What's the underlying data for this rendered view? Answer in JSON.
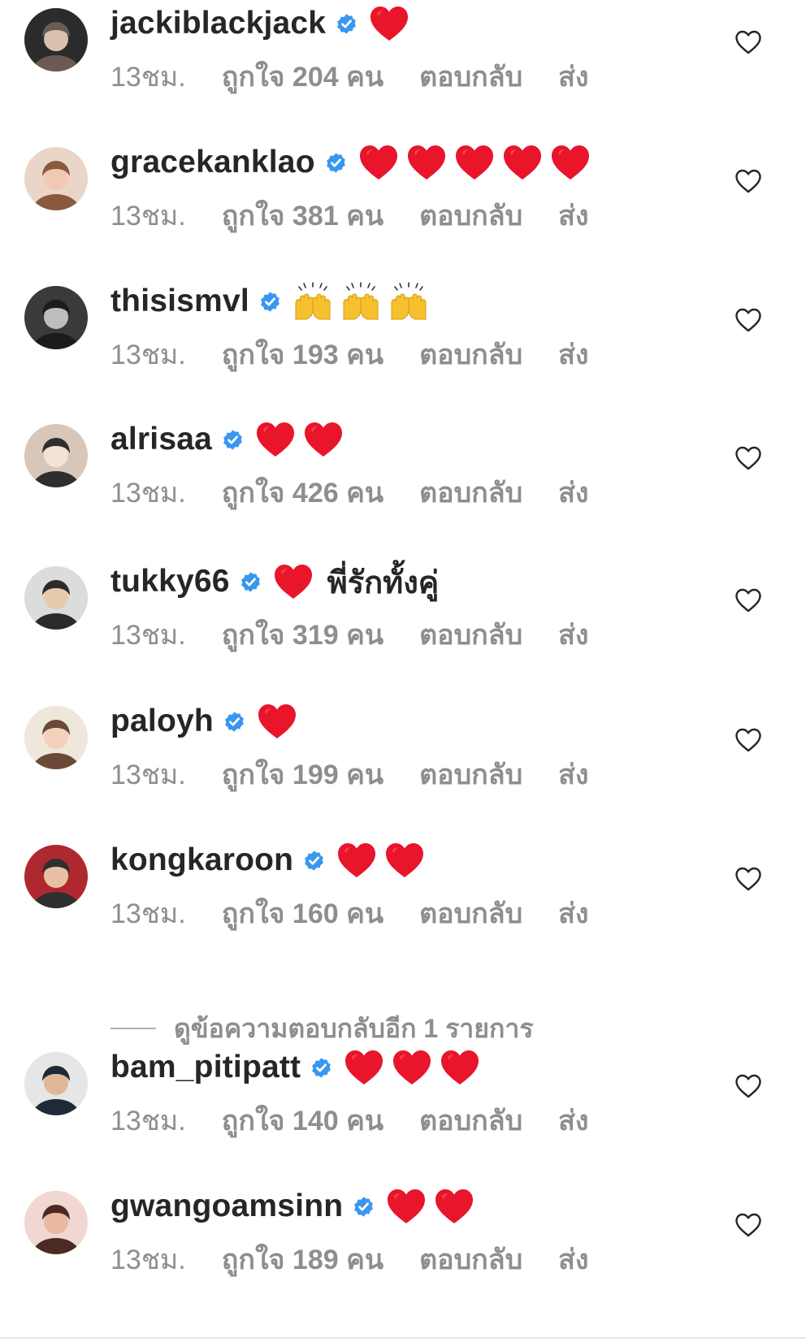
{
  "colors": {
    "text": "#262626",
    "meta": "#8e8e8e",
    "verified_blue": "#3897f0",
    "heart_red": "#e0245e"
  },
  "icons": {
    "verified": "verified-badge-icon",
    "like": "heart-outline-icon",
    "emoji_heart": "red-heart-emoji",
    "emoji_hands": "raising-hands-emoji"
  },
  "comments": [
    {
      "username": "jackiblackjack",
      "emoji": [
        "heart"
      ],
      "text": "",
      "time": "13ชม.",
      "likes": "ถูกใจ 204 คน",
      "reply": "ตอบกลับ",
      "send": "ส่ง"
    },
    {
      "username": "gracekanklao",
      "emoji": [
        "heart",
        "heart",
        "heart",
        "heart",
        "heart"
      ],
      "text": "",
      "time": "13ชม.",
      "likes": "ถูกใจ 381 คน",
      "reply": "ตอบกลับ",
      "send": "ส่ง"
    },
    {
      "username": "thisismvl",
      "emoji": [
        "hands",
        "hands",
        "hands"
      ],
      "text": "",
      "time": "13ชม.",
      "likes": "ถูกใจ 193 คน",
      "reply": "ตอบกลับ",
      "send": "ส่ง"
    },
    {
      "username": "alrisaa",
      "emoji": [
        "heart",
        "heart"
      ],
      "text": "",
      "time": "13ชม.",
      "likes": "ถูกใจ 426 คน",
      "reply": "ตอบกลับ",
      "send": "ส่ง"
    },
    {
      "username": "tukky66",
      "emoji": [
        "heart"
      ],
      "text": "พี่รักทั้งคู่",
      "time": "13ชม.",
      "likes": "ถูกใจ 319 คน",
      "reply": "ตอบกลับ",
      "send": "ส่ง"
    },
    {
      "username": "paloyh",
      "emoji": [
        "heart"
      ],
      "text": "",
      "time": "13ชม.",
      "likes": "ถูกใจ 199 คน",
      "reply": "ตอบกลับ",
      "send": "ส่ง"
    },
    {
      "username": "kongkaroon",
      "emoji": [
        "heart",
        "heart"
      ],
      "text": "",
      "time": "13ชม.",
      "likes": "ถูกใจ 160 คน",
      "reply": "ตอบกลับ",
      "send": "ส่ง"
    },
    {
      "username": "bam_pitipatt",
      "emoji": [
        "heart",
        "heart",
        "heart"
      ],
      "text": "",
      "time": "13ชม.",
      "likes": "ถูกใจ 140 คน",
      "reply": "ตอบกลับ",
      "send": "ส่ง"
    },
    {
      "username": "gwangoamsinn",
      "emoji": [
        "heart",
        "heart"
      ],
      "text": "",
      "time": "13ชม.",
      "likes": "ถูกใจ 189 คน",
      "reply": "ตอบกลับ",
      "send": "ส่ง"
    }
  ],
  "view_replies": {
    "label": "ดูข้อความตอบกลับอีก 1 รายการ"
  }
}
